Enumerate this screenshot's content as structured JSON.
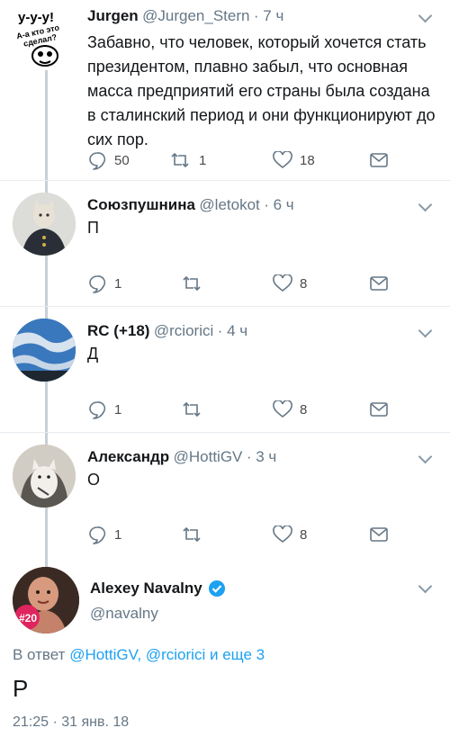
{
  "tweets": [
    {
      "name": "Jurgen",
      "handle": "@Jurgen_Stern",
      "time": "· 7 ч",
      "text": "Забавно, что человек, который хочется стать президентом, плавно забыл, что основная масса предприятий его страны была создана в сталинский период и они функционируют до сих пор.",
      "avatar_text": "у-у-у! А-а кто это сделал?",
      "replies": "50",
      "retweets": "1",
      "likes": "18"
    },
    {
      "name": "Союзпушнина",
      "handle": "@letokot",
      "time": "· 6 ч",
      "text": "П",
      "replies": "1",
      "retweets": "",
      "likes": "8"
    },
    {
      "name": "RC (+18)",
      "handle": "@rciorici",
      "time": "· 4 ч",
      "text": "Д",
      "replies": "1",
      "retweets": "",
      "likes": "8"
    },
    {
      "name": "Александр",
      "handle": "@HottiGV",
      "time": "· 3 ч",
      "text": "О",
      "replies": "1",
      "retweets": "",
      "likes": "8"
    }
  ],
  "main": {
    "name": "Alexey Navalny",
    "handle": "@navalny",
    "avatar_badge": "#20",
    "reply_prefix": "В ответ",
    "reply_mention1": "@HottiGV,",
    "reply_mention2": "@rciorici",
    "reply_suffix": "и еще 3",
    "text": "Р",
    "timestamp": "21:25 · 31 янв. 18"
  },
  "colors": {
    "accent": "#1da1f2",
    "verified": "#1da1f2",
    "muted": "#657786",
    "thread": "#c6d0d6"
  }
}
